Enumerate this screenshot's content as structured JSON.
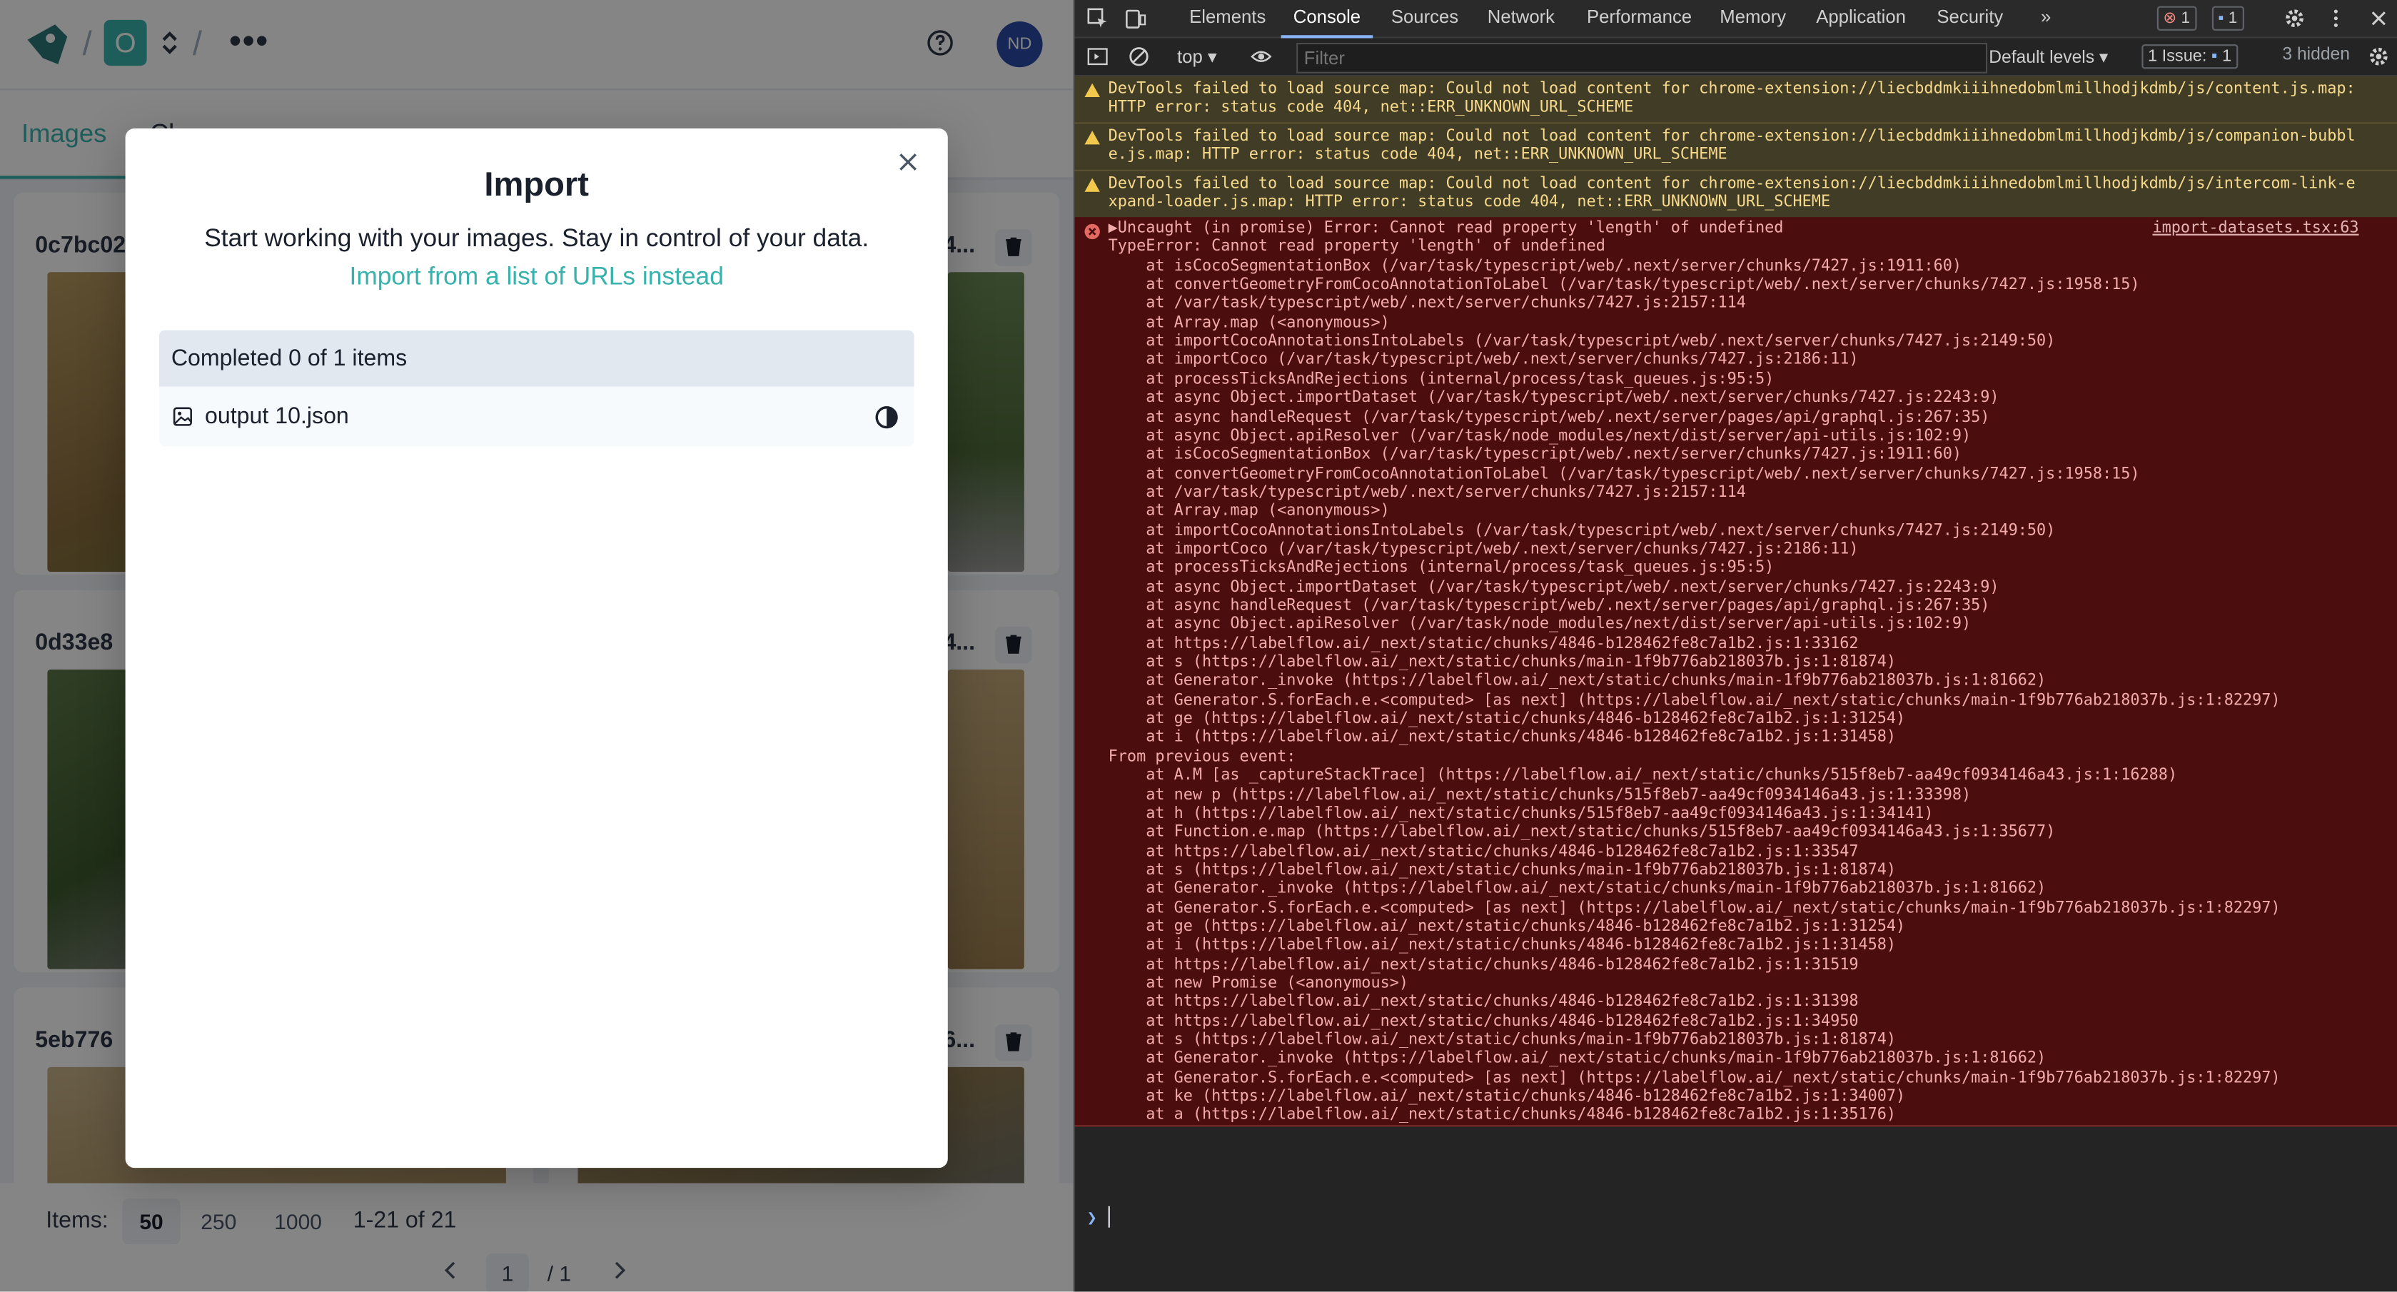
{
  "app": {
    "dataset_badge": "O",
    "more_label": "•••",
    "avatar_initials": "ND",
    "tabs": [
      "Images",
      "Cl"
    ],
    "cards": [
      {
        "title": "0c7bc02",
        "right_title": "4..."
      },
      {
        "title": "0d33e8",
        "right_title": "4..."
      },
      {
        "title": "5eb776",
        "right_title": "6..."
      }
    ],
    "pagination": {
      "items_label": "Items:",
      "sizes": [
        "50",
        "250",
        "1000"
      ],
      "selected_size": "50",
      "range": "1-21 of 21",
      "page": "1",
      "total": "/ 1"
    }
  },
  "modal": {
    "title": "Import",
    "subtitle": "Start working with your images. Stay in control of your data.",
    "link": "Import from a list of URLs instead",
    "progress": "Completed 0 of 1 items",
    "file": "output 10.json"
  },
  "devtools": {
    "tabs": [
      "Elements",
      "Console",
      "Sources",
      "Network",
      "Performance",
      "Memory",
      "Application",
      "Security"
    ],
    "active_tab": "Console",
    "error_count": "1",
    "message_count": "1",
    "context": "top",
    "filter_placeholder": "Filter",
    "levels": "Default levels",
    "issues_label": "1 Issue:",
    "issues_count": "1",
    "hidden": "3 hidden",
    "warnings": [
      "DevTools failed to load source map: Could not load content for chrome-extension://liecbddmkiiihnedobmlmillhodjkdmb/js/content.js.map:\nHTTP error: status code 404, net::ERR_UNKNOWN_URL_SCHEME",
      "DevTools failed to load source map: Could not load content for chrome-extension://liecbddmkiiihnedobmlmillhodjkdmb/js/companion-bubbl\ne.js.map: HTTP error: status code 404, net::ERR_UNKNOWN_URL_SCHEME",
      "DevTools failed to load source map: Could not load content for chrome-extension://liecbddmkiiihnedobmlmillhodjkdmb/js/intercom-link-e\nxpand-loader.js.map: HTTP error: status code 404, net::ERR_UNKNOWN_URL_SCHEME"
    ],
    "error_source": "import-datasets.tsx:63",
    "error_lines": [
      "▶Uncaught (in promise) Error: Cannot read property 'length' of undefined",
      "TypeError: Cannot read property 'length' of undefined",
      "    at isCocoSegmentationBox (/var/task/typescript/web/.next/server/chunks/7427.js:1911:60)",
      "    at convertGeometryFromCocoAnnotationToLabel (/var/task/typescript/web/.next/server/chunks/7427.js:1958:15)",
      "    at /var/task/typescript/web/.next/server/chunks/7427.js:2157:114",
      "    at Array.map (<anonymous>)",
      "    at importCocoAnnotationsIntoLabels (/var/task/typescript/web/.next/server/chunks/7427.js:2149:50)",
      "    at importCoco (/var/task/typescript/web/.next/server/chunks/7427.js:2186:11)",
      "    at processTicksAndRejections (internal/process/task_queues.js:95:5)",
      "    at async Object.importDataset (/var/task/typescript/web/.next/server/chunks/7427.js:2243:9)",
      "    at async handleRequest (/var/task/typescript/web/.next/server/pages/api/graphql.js:267:35)",
      "    at async Object.apiResolver (/var/task/node_modules/next/dist/server/api-utils.js:102:9)",
      "    at isCocoSegmentationBox (/var/task/typescript/web/.next/server/chunks/7427.js:1911:60)",
      "    at convertGeometryFromCocoAnnotationToLabel (/var/task/typescript/web/.next/server/chunks/7427.js:1958:15)",
      "    at /var/task/typescript/web/.next/server/chunks/7427.js:2157:114",
      "    at Array.map (<anonymous>)",
      "    at importCocoAnnotationsIntoLabels (/var/task/typescript/web/.next/server/chunks/7427.js:2149:50)",
      "    at importCoco (/var/task/typescript/web/.next/server/chunks/7427.js:2186:11)",
      "    at processTicksAndRejections (internal/process/task_queues.js:95:5)",
      "    at async Object.importDataset (/var/task/typescript/web/.next/server/chunks/7427.js:2243:9)",
      "    at async handleRequest (/var/task/typescript/web/.next/server/pages/api/graphql.js:267:35)",
      "    at async Object.apiResolver (/var/task/node_modules/next/dist/server/api-utils.js:102:9)",
      "    at https://labelflow.ai/_next/static/chunks/4846-b128462fe8c7a1b2.js:1:33162",
      "    at s (https://labelflow.ai/_next/static/chunks/main-1f9b776ab218037b.js:1:81874)",
      "    at Generator._invoke (https://labelflow.ai/_next/static/chunks/main-1f9b776ab218037b.js:1:81662)",
      "    at Generator.S.forEach.e.<computed> [as next] (https://labelflow.ai/_next/static/chunks/main-1f9b776ab218037b.js:1:82297)",
      "    at ge (https://labelflow.ai/_next/static/chunks/4846-b128462fe8c7a1b2.js:1:31254)",
      "    at i (https://labelflow.ai/_next/static/chunks/4846-b128462fe8c7a1b2.js:1:31458)",
      "From previous event:",
      "    at A.M [as _captureStackTrace] (https://labelflow.ai/_next/static/chunks/515f8eb7-aa49cf0934146a43.js:1:16288)",
      "    at new p (https://labelflow.ai/_next/static/chunks/515f8eb7-aa49cf0934146a43.js:1:33398)",
      "    at h (https://labelflow.ai/_next/static/chunks/515f8eb7-aa49cf0934146a43.js:1:34141)",
      "    at Function.e.map (https://labelflow.ai/_next/static/chunks/515f8eb7-aa49cf0934146a43.js:1:35677)",
      "    at https://labelflow.ai/_next/static/chunks/4846-b128462fe8c7a1b2.js:1:33547",
      "    at s (https://labelflow.ai/_next/static/chunks/main-1f9b776ab218037b.js:1:81874)",
      "    at Generator._invoke (https://labelflow.ai/_next/static/chunks/main-1f9b776ab218037b.js:1:81662)",
      "    at Generator.S.forEach.e.<computed> [as next] (https://labelflow.ai/_next/static/chunks/main-1f9b776ab218037b.js:1:82297)",
      "    at ge (https://labelflow.ai/_next/static/chunks/4846-b128462fe8c7a1b2.js:1:31254)",
      "    at i (https://labelflow.ai/_next/static/chunks/4846-b128462fe8c7a1b2.js:1:31458)",
      "    at https://labelflow.ai/_next/static/chunks/4846-b128462fe8c7a1b2.js:1:31519",
      "    at new Promise (<anonymous>)",
      "    at https://labelflow.ai/_next/static/chunks/4846-b128462fe8c7a1b2.js:1:31398",
      "    at https://labelflow.ai/_next/static/chunks/4846-b128462fe8c7a1b2.js:1:34950",
      "    at s (https://labelflow.ai/_next/static/chunks/main-1f9b776ab218037b.js:1:81874)",
      "    at Generator._invoke (https://labelflow.ai/_next/static/chunks/main-1f9b776ab218037b.js:1:81662)",
      "    at Generator.S.forEach.e.<computed> [as next] (https://labelflow.ai/_next/static/chunks/main-1f9b776ab218037b.js:1:82297)",
      "    at ke (https://labelflow.ai/_next/static/chunks/4846-b128462fe8c7a1b2.js:1:34007)",
      "    at a (https://labelflow.ai/_next/static/chunks/4846-b128462fe8c7a1b2.js:1:35176)"
    ]
  },
  "colors": {
    "accent": "#38b2ac",
    "error_bg": "#4b0d0d",
    "warning_bg": "#413c25"
  },
  "icons": [
    "logo-icon",
    "chevron-updown-icon",
    "help-icon",
    "trash-icon",
    "close-icon",
    "image-file-icon",
    "half-circle-status-icon",
    "chevron-left-icon",
    "chevron-right-icon",
    "inspect-icon",
    "device-icon",
    "gear-icon",
    "kebab-icon",
    "sidebar-toggle-icon",
    "clear-console-icon",
    "eye-icon",
    "warning-icon",
    "error-icon"
  ]
}
